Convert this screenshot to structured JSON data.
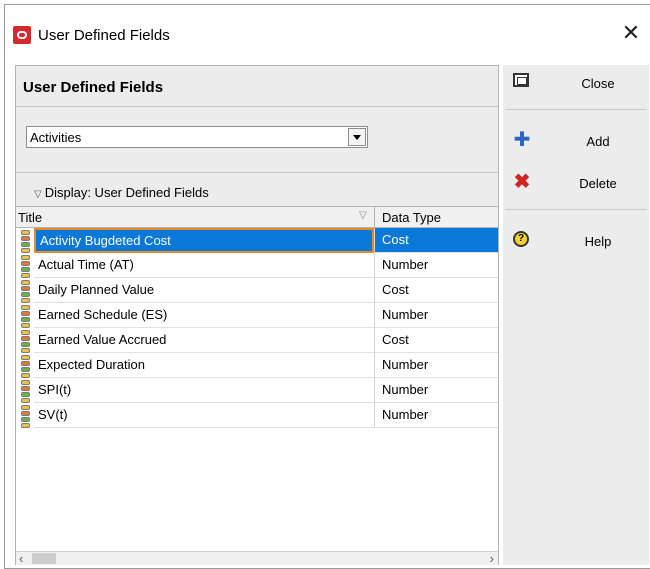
{
  "window": {
    "title": "User Defined Fields",
    "close_glyph": "✕"
  },
  "panel": {
    "section_title": "User Defined Fields",
    "subject_area": "Activities",
    "group_header": "Display: User Defined Fields"
  },
  "grid": {
    "columns": [
      "Title",
      "Data Type"
    ],
    "rows": [
      {
        "title": "Activity Bugdeted Cost",
        "type": "Cost",
        "selected": true
      },
      {
        "title": "Actual Time (AT)",
        "type": "Number"
      },
      {
        "title": "Daily Planned Value",
        "type": "Cost"
      },
      {
        "title": "Earned Schedule (ES)",
        "type": "Number"
      },
      {
        "title": "Earned Value Accrued",
        "type": "Cost"
      },
      {
        "title": "Expected Duration",
        "type": "Number"
      },
      {
        "title": "SPI(t)",
        "type": "Number"
      },
      {
        "title": "SV(t)",
        "type": "Number"
      }
    ]
  },
  "buttons": {
    "close": "Close",
    "add": "Add",
    "delete": "Delete",
    "help": "Help"
  },
  "icons": {
    "app": "oracle-primavera-icon",
    "close": "close-window-icon",
    "add": "plus-icon",
    "delete": "red-x-icon",
    "help": "question-icon",
    "row": "udf-field-icon"
  },
  "colors": {
    "selection": "#0a78d7",
    "selection_border": "#e88a2a",
    "panel_bg": "#ececec"
  }
}
